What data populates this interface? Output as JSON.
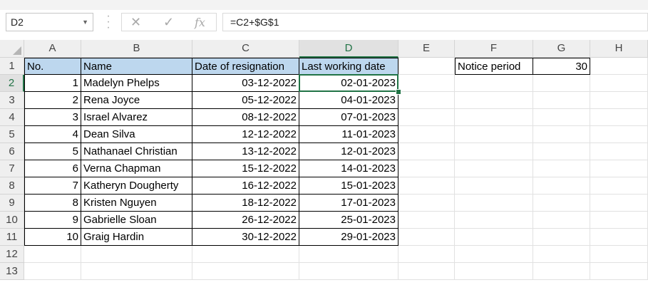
{
  "name_box": {
    "value": "D2"
  },
  "formula_bar": {
    "cancel_icon": "close-icon",
    "enter_icon": "check-icon",
    "fx_label": "fx",
    "value": "=C2+$G$1"
  },
  "columns": [
    "A",
    "B",
    "C",
    "D",
    "E",
    "F",
    "G",
    "H"
  ],
  "rows": [
    "1",
    "2",
    "3",
    "4",
    "5",
    "6",
    "7",
    "8",
    "9",
    "10",
    "11",
    "12",
    "13"
  ],
  "header": {
    "no": "No.",
    "name": "Name",
    "date": "Date of resignation",
    "last": "Last working date"
  },
  "notice": {
    "label": "Notice period",
    "value": "30"
  },
  "records": [
    {
      "no": "1",
      "name": "Madelyn Phelps",
      "date": "03-12-2022",
      "last": "02-01-2023"
    },
    {
      "no": "2",
      "name": "Rena Joyce",
      "date": "05-12-2022",
      "last": "04-01-2023"
    },
    {
      "no": "3",
      "name": "Israel Alvarez",
      "date": "08-12-2022",
      "last": "07-01-2023"
    },
    {
      "no": "4",
      "name": "Dean Silva",
      "date": "12-12-2022",
      "last": "11-01-2023"
    },
    {
      "no": "5",
      "name": "Nathanael Christian",
      "date": "13-12-2022",
      "last": "12-01-2023"
    },
    {
      "no": "6",
      "name": "Verna Chapman",
      "date": "15-12-2022",
      "last": "14-01-2023"
    },
    {
      "no": "7",
      "name": "Katheryn Dougherty",
      "date": "16-12-2022",
      "last": "15-01-2023"
    },
    {
      "no": "8",
      "name": "Kristen Nguyen",
      "date": "18-12-2022",
      "last": "17-01-2023"
    },
    {
      "no": "9",
      "name": "Gabrielle Sloan",
      "date": "26-12-2022",
      "last": "25-01-2023"
    },
    {
      "no": "10",
      "name": "Graig Hardin",
      "date": "30-12-2022",
      "last": "29-01-2023"
    }
  ],
  "selected": {
    "column": "D",
    "row": "2"
  },
  "colors": {
    "header_fill": "#bdd7ee",
    "accent": "#217346"
  }
}
